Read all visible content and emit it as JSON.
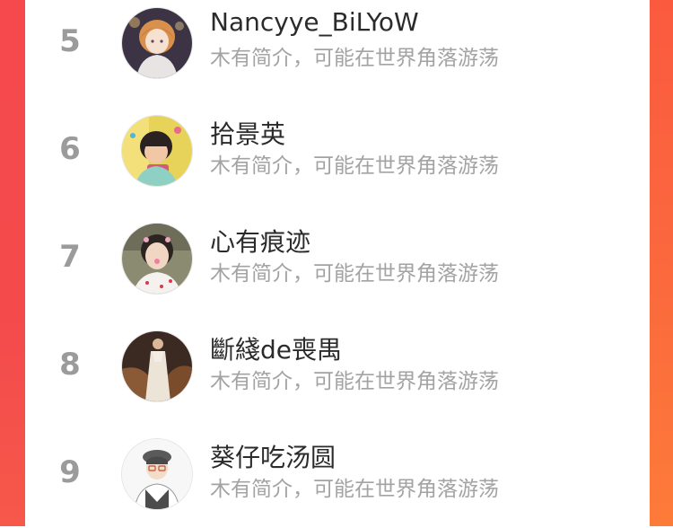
{
  "users": [
    {
      "rank": "5",
      "name": "Nancyye_BiLYoW",
      "bio": "木有简介，可能在世界角落游荡",
      "avatar_icon": "anime-girl-avatar-icon"
    },
    {
      "rank": "6",
      "name": "拾景英",
      "bio": "木有简介，可能在世界角落游荡",
      "avatar_icon": "child-photo-avatar-icon"
    },
    {
      "rank": "7",
      "name": "心有痕迹",
      "bio": "木有简介，可能在世界角落游荡",
      "avatar_icon": "girl-selfie-avatar-icon"
    },
    {
      "rank": "8",
      "name": "斷綫de喪禺",
      "bio": "木有简介，可能在世界角落游荡",
      "avatar_icon": "woman-dress-avatar-icon"
    },
    {
      "rank": "9",
      "name": "葵仔吃汤圆",
      "bio": "木有简介，可能在世界角落游荡",
      "avatar_icon": "cartoon-boy-avatar-icon"
    }
  ],
  "colors": {
    "rank": "#9b9b9b",
    "name": "#2b2b2b",
    "bio": "#a3a3a3",
    "left_band": "#f5494e",
    "right_band": "#fd7b39"
  }
}
